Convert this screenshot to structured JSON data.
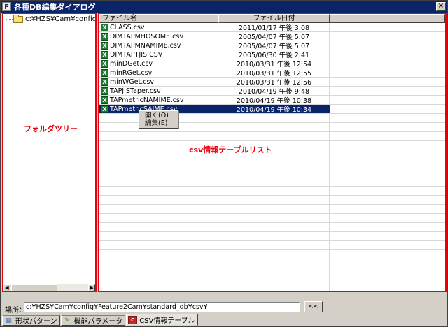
{
  "window": {
    "app_icon_letter": "F",
    "title": "各種DB編集ダイアログ",
    "close_label": "×"
  },
  "tree": {
    "path_label": "c:¥HZS¥Cam¥config¥Featu",
    "annotation": "フォルダツリー"
  },
  "list": {
    "columns": {
      "name": "ファイル名",
      "date": "ファイル日付"
    },
    "files": [
      {
        "name": "CLASS.csv",
        "date": "2011/01/17 午後 3:08"
      },
      {
        "name": "DIMTAPMHOSOME.csv",
        "date": "2005/04/07 午後 5:07"
      },
      {
        "name": "DIMTAPMNAMIME.csv",
        "date": "2005/04/07 午後 5:07"
      },
      {
        "name": "DIMTAPTJIS.CSV",
        "date": "2005/06/30 午後 2:41"
      },
      {
        "name": "minDGet.csv",
        "date": "2010/03/31 午後 12:54"
      },
      {
        "name": "minRGet.csv",
        "date": "2010/03/31 午後 12:55"
      },
      {
        "name": "minWGet.csv",
        "date": "2010/03/31 午後 12:56"
      },
      {
        "name": "TAPJISTaper.csv",
        "date": "2010/04/19 午後 9:48"
      },
      {
        "name": "TAPmetricNAMIME.csv",
        "date": "2010/04/19 午後 10:38"
      },
      {
        "name": "TAPmetricSAIME.csv",
        "date": "2010/04/19 午後 10:34",
        "selected": true
      }
    ],
    "annotation": "csv情報テーブルリスト"
  },
  "context_menu": {
    "items": [
      {
        "label": "開く(O)"
      },
      {
        "label": "編集(E)"
      }
    ]
  },
  "location": {
    "label": "場所：",
    "value": "c:¥HZS¥Cam¥config¥Feature2Cam¥standard_db¥csv¥",
    "back_label": "<<"
  },
  "tabs": [
    {
      "label": "形状パターン",
      "icon": "shape-icon",
      "active": false
    },
    {
      "label": "機能パラメータ",
      "icon": "parameter-icon",
      "active": false
    },
    {
      "label": "CSV情報テーブル",
      "icon": "csv-icon",
      "active": true
    }
  ],
  "colors": {
    "title_bar": "#0a246a",
    "annotation_red": "#e8000b",
    "selection": "#0a246a"
  }
}
